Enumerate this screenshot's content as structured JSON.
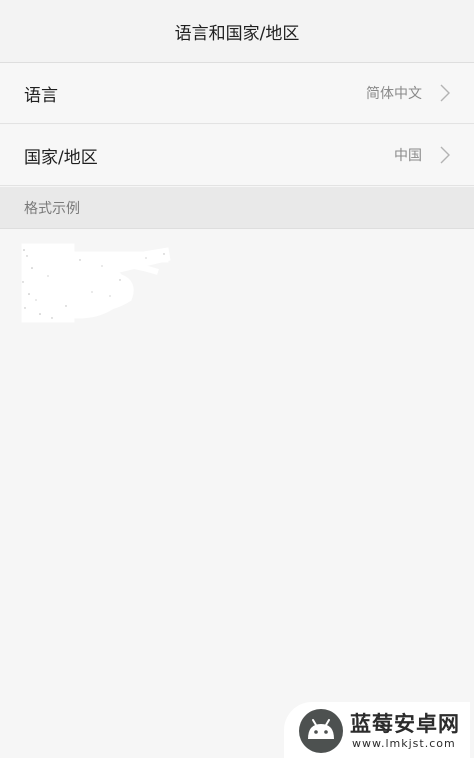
{
  "header": {
    "title": "语言和国家/地区"
  },
  "rows": [
    {
      "label": "语言",
      "value": "简体中文",
      "icon": "chevron-right-icon"
    },
    {
      "label": "国家/地区",
      "value": "中国",
      "icon": "chevron-right-icon"
    }
  ],
  "section": {
    "label": "格式示例"
  },
  "watermark": {
    "name": "蓝莓安卓网",
    "url": "www.lmkjst.com",
    "icon": "android-logo-icon"
  },
  "colors": {
    "background": "#f6f6f6",
    "header": "#f3f3f3",
    "section": "#e9e9e9",
    "value_text": "#8a8a8a"
  }
}
